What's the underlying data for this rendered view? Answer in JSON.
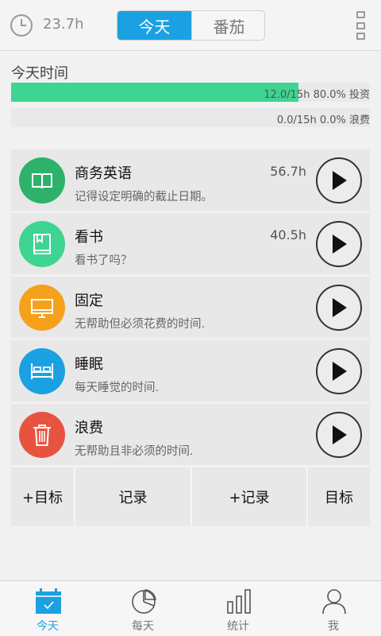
{
  "header": {
    "total_hours": "23.7h",
    "tabs": [
      {
        "label": "今天",
        "active": true
      },
      {
        "label": "番茄",
        "active": false
      }
    ]
  },
  "today": {
    "title": "今天时间",
    "invest": {
      "text": "12.0/15h 80.0% 投资",
      "fraction": 0.8,
      "color": "#3ed491"
    },
    "waste": {
      "text": "0.0/15h 0.0% 浪费",
      "fraction": 0.0,
      "color": "#3ed491"
    }
  },
  "activities": [
    {
      "name": "商务英语",
      "desc": "记得设定明确的截止日期。",
      "hours": "56.7h",
      "color": "#2eb26a",
      "icon": "book-icon"
    },
    {
      "name": "看书",
      "desc": "看书了吗？",
      "hours": "40.5h",
      "color": "#3ed491",
      "icon": "bookmark-book-icon"
    },
    {
      "name": "固定",
      "desc": "无帮助但必须花费的时间.",
      "hours": "",
      "color": "#f5a11b",
      "icon": "monitor-icon"
    },
    {
      "name": "睡眠",
      "desc": "每天睡觉的时间.",
      "hours": "",
      "color": "#1ba1e2",
      "icon": "bed-icon"
    },
    {
      "name": "浪费",
      "desc": "无帮助且非必须的时间.",
      "hours": "",
      "color": "#e8533f",
      "icon": "trash-icon"
    }
  ],
  "actions": [
    "+目标",
    "记录",
    "+记录",
    "目标"
  ],
  "nav": [
    {
      "label": "今天",
      "icon": "calendar-check-icon",
      "active": true
    },
    {
      "label": "每天",
      "icon": "pie-chart-icon",
      "active": false
    },
    {
      "label": "统计",
      "icon": "bar-chart-icon",
      "active": false
    },
    {
      "label": "我",
      "icon": "user-icon",
      "active": false
    }
  ],
  "colors": {
    "accent": "#1ba1e2",
    "progress": "#3ed491"
  }
}
